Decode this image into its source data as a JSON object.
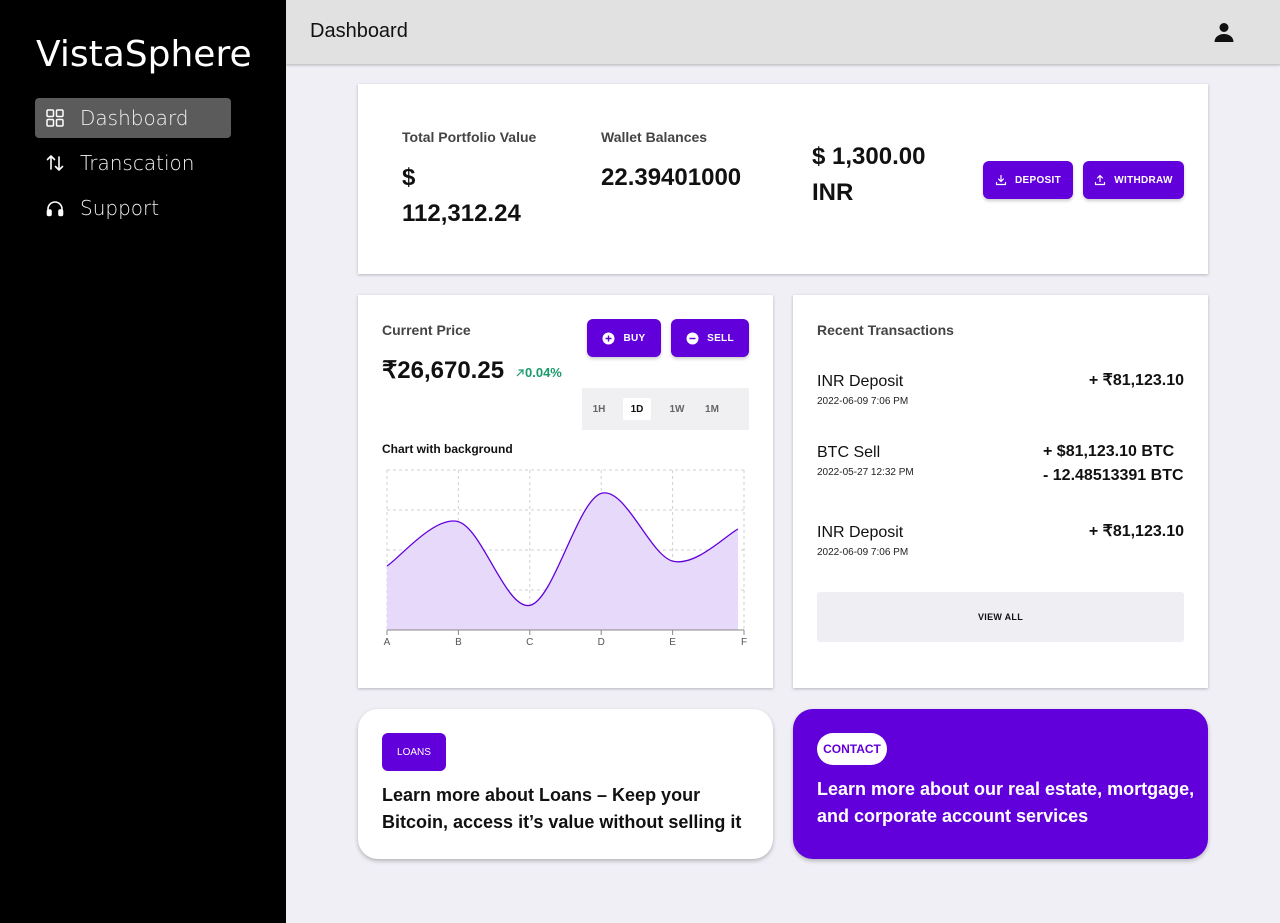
{
  "app": {
    "brand": "VistaSphere"
  },
  "sidebar": {
    "items": [
      {
        "label": "Dashboard",
        "icon": "grid-icon",
        "active": true
      },
      {
        "label": "Transcation",
        "icon": "arrows-updown-icon",
        "active": false
      },
      {
        "label": "Support",
        "icon": "headphones-icon",
        "active": false
      }
    ]
  },
  "header": {
    "title": "Dashboard",
    "icon": "user-icon"
  },
  "portfolio": {
    "total_label": "Total Portfolio Value",
    "total_value_line1": "$",
    "total_value_line2": "112,312.24",
    "wallet_label": "Wallet Balances",
    "wallet_value": "22.39401000",
    "inr_line1": "$ 1,300.00",
    "inr_line2": "INR",
    "deposit_label": "DEPOSIT",
    "withdraw_label": "WITHDRAW"
  },
  "price": {
    "label": "Current Price",
    "value": "₹26,670.25",
    "change": "0.04%",
    "buy_label": "BUY",
    "sell_label": "SELL",
    "timeframes": [
      "1H",
      "1D",
      "1W",
      "1M"
    ],
    "active_timeframe": "1D",
    "chart_title": "Chart with background"
  },
  "chart_data": {
    "type": "area",
    "title": "Chart with background",
    "categories": [
      "A",
      "B",
      "C",
      "D",
      "E",
      "F"
    ],
    "series": [
      {
        "values": [
          52,
          88,
          20,
          111,
          56,
          82
        ]
      }
    ],
    "ylim": [
      0,
      130
    ],
    "grid": true,
    "color": "#6200dc",
    "fill": "#e6d9f9"
  },
  "transactions": {
    "title": "Recent Transactions",
    "items": [
      {
        "name": "INR Deposit",
        "date": "2022-06-09 7:06 PM",
        "amount": "+ ₹81,123.10",
        "amount2": ""
      },
      {
        "name": "BTC Sell",
        "date": "2022-05-27 12:32 PM",
        "amount": "+ $81,123.10 BTC",
        "amount2": "- 12.48513391 BTC"
      },
      {
        "name": "INR Deposit",
        "date": "2022-06-09 7:06 PM",
        "amount": "+ ₹81,123.10",
        "amount2": ""
      }
    ],
    "view_all": "VIEW ALL"
  },
  "loans": {
    "badge": "LOANS",
    "text": "Learn more about Loans – Keep your Bitcoin, access it’s value without selling it"
  },
  "contact": {
    "badge": "CONTACT",
    "text": "Learn more about our real estate, mortgage, and corporate account services"
  },
  "colors": {
    "accent": "#6200dc",
    "positive": "#1a9a6c",
    "sidebar": "#000000"
  }
}
